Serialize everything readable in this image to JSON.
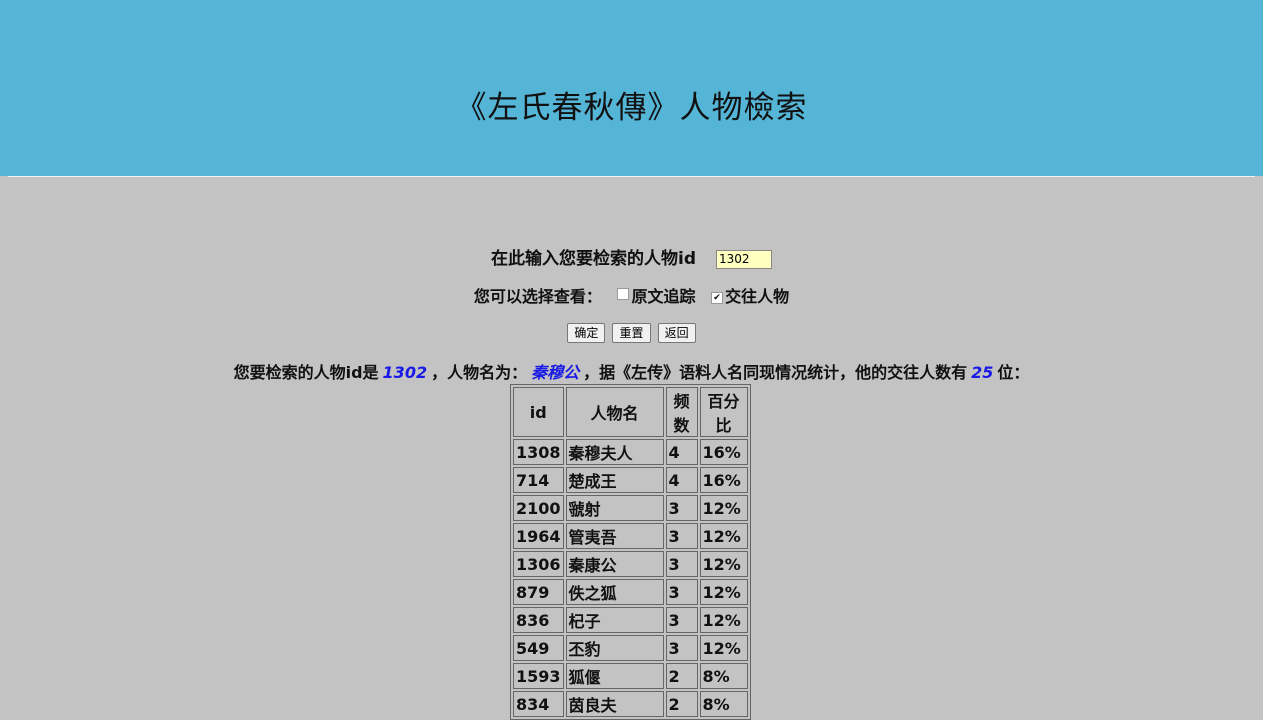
{
  "header": {
    "title": "《左氏春秋傳》人物檢索"
  },
  "form": {
    "id_label": "在此输入您要检索的人物id",
    "id_value": "1302",
    "options_label": "您可以选择查看：",
    "option_source": {
      "label": "原文追踪",
      "checked": false
    },
    "option_contacts": {
      "label": "交往人物",
      "checked": true
    }
  },
  "buttons": {
    "confirm": "确定",
    "reset": "重置",
    "back": "返回"
  },
  "summary": {
    "prefix": "您要检索的人物id是",
    "id": "1302",
    "mid": "，人物名为：",
    "name": "秦穆公",
    "mid2": "，据《左传》语料人名同现情况统计，他的交往人数有",
    "count": "25",
    "suffix": "位："
  },
  "table": {
    "headers": [
      "id",
      "人物名",
      "频数",
      "百分比"
    ],
    "rows": [
      [
        "1308",
        "秦穆夫人",
        "4",
        "16%"
      ],
      [
        "714",
        "楚成王",
        "4",
        "16%"
      ],
      [
        "2100",
        "虢射",
        "3",
        "12%"
      ],
      [
        "1964",
        "管夷吾",
        "3",
        "12%"
      ],
      [
        "1306",
        "秦康公",
        "3",
        "12%"
      ],
      [
        "879",
        "佚之狐",
        "3",
        "12%"
      ],
      [
        "836",
        "杞子",
        "3",
        "12%"
      ],
      [
        "549",
        "丕豹",
        "3",
        "12%"
      ],
      [
        "1593",
        "狐偃",
        "2",
        "8%"
      ],
      [
        "834",
        "茵良夫",
        "2",
        "8%"
      ]
    ]
  }
}
